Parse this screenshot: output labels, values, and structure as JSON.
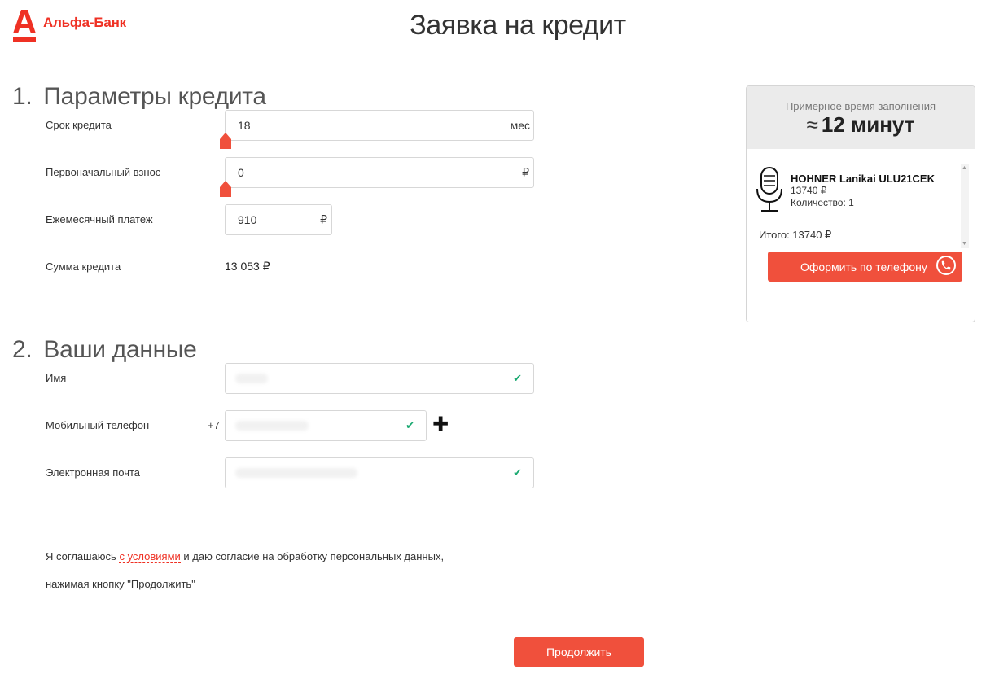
{
  "brand": {
    "name": "Альфа-Банк",
    "color": "#ef3124"
  },
  "page_title": "Заявка на кредит",
  "section1": {
    "number": "1.",
    "title": "Параметры кредита",
    "term": {
      "label": "Срок кредита",
      "value": "18",
      "unit": "мес"
    },
    "down_payment": {
      "label": "Первоначальный взнос",
      "value": "0",
      "unit": "₽"
    },
    "monthly": {
      "label": "Ежемесячный платеж",
      "value": "910",
      "unit": "₽"
    },
    "sum": {
      "label": "Сумма кредита",
      "value": "13 053 ₽"
    }
  },
  "section2": {
    "number": "2.",
    "title": "Ваши данные",
    "name": {
      "label": "Имя"
    },
    "phone": {
      "label": "Мобильный телефон",
      "prefix": "+7"
    },
    "email": {
      "label": "Электронная почта"
    }
  },
  "consent": {
    "before": "Я соглашаюсь ",
    "link": "с условиями",
    "after": " и даю согласие на обработку персональных данных,",
    "line2": "нажимая кнопку \"Продолжить\""
  },
  "continue_label": "Продолжить",
  "sidebar": {
    "time_caption": "Примерное время заполнения",
    "time_approx": "≈",
    "time_value": "12 минут",
    "product": {
      "name": "HOHNER Lanikai ULU21CEK",
      "price": "13740 ₽",
      "qty": "Количество: 1",
      "icon": "microphone-icon"
    },
    "total": "Итого: 13740 ₽",
    "phone_button": "Оформить по телефону"
  },
  "icons": {
    "check": "✔",
    "plus": "✚"
  }
}
